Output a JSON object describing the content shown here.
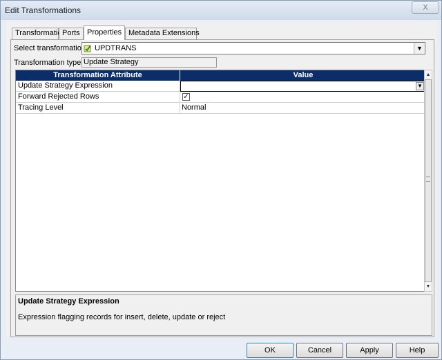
{
  "window": {
    "title": "Edit Transformations",
    "close_glyph": "X"
  },
  "tabs": [
    {
      "label": "Transformation",
      "active": false
    },
    {
      "label": "Ports",
      "active": false
    },
    {
      "label": "Properties",
      "active": true
    },
    {
      "label": "Metadata Extensions",
      "active": false
    }
  ],
  "select_transformation": {
    "label": "Select transformation:",
    "value": "UPDTRANS",
    "icon": "update-strategy-icon"
  },
  "transformation_type": {
    "label": "Transformation type:",
    "value": "Update Strategy"
  },
  "grid": {
    "headers": [
      "Transformation Attribute",
      "Value"
    ],
    "header_color": "#0b2e6b",
    "rows": [
      {
        "attribute": "Update Strategy Expression",
        "value": ""
      },
      {
        "attribute": "Forward Rejected Rows",
        "value": "",
        "checked": true
      },
      {
        "attribute": "Tracing Level",
        "value": "Normal"
      }
    ]
  },
  "description": {
    "title": "Update Strategy Expression",
    "text": "Expression flagging records for insert, delete, update or reject"
  },
  "buttons": {
    "ok": "OK",
    "cancel": "Cancel",
    "apply": "Apply",
    "help": "Help"
  }
}
